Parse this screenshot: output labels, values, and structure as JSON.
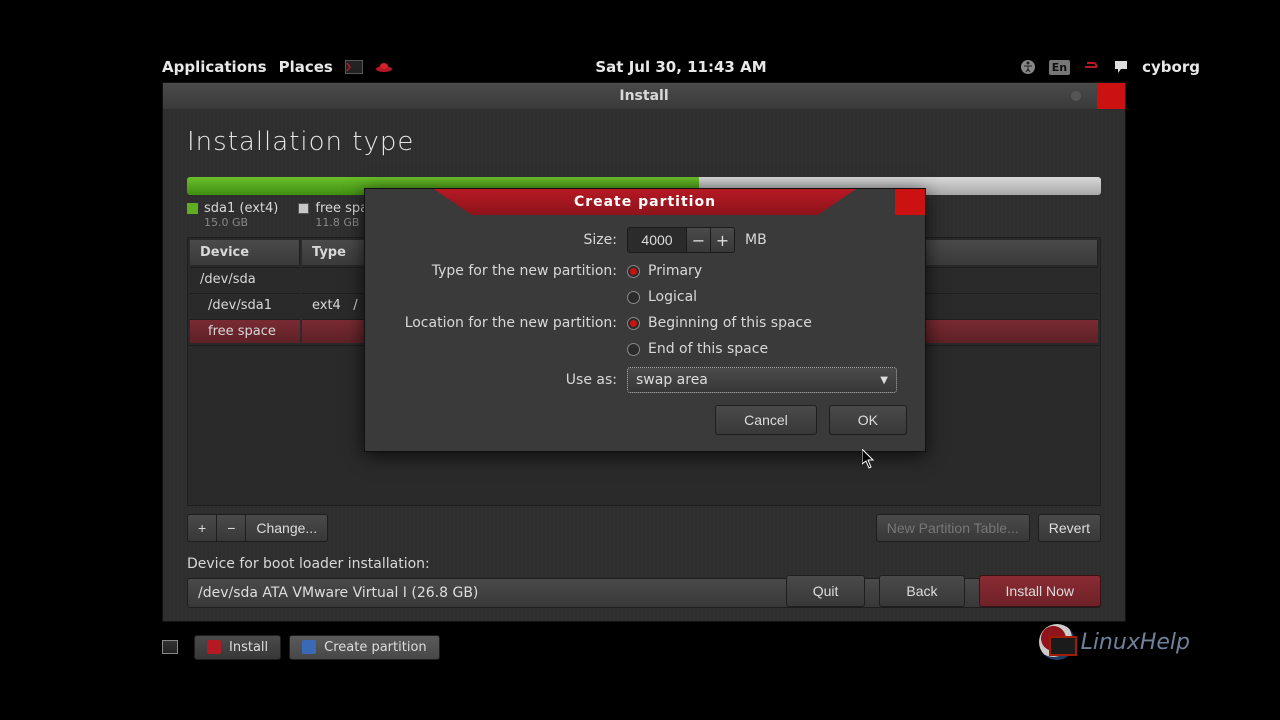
{
  "panel": {
    "apps": "Applications",
    "places": "Places",
    "clock": "Sat Jul 30, 11:43 AM",
    "lang": "En",
    "user": "cyborg"
  },
  "installer": {
    "window_title": "Install",
    "heading": "Installation type",
    "partitions_bar": {
      "seg1_label": "sda1 (ext4)",
      "seg1_size": "15.0 GB",
      "seg2_label": "free space",
      "seg2_size": "11.8 GB"
    },
    "table": {
      "headers": {
        "device": "Device",
        "type": "Type"
      },
      "rows": [
        {
          "device": "/dev/sda",
          "type": ""
        },
        {
          "device": "/dev/sda1",
          "type": "ext4",
          "mount": "/"
        },
        {
          "device": "free space",
          "type": ""
        }
      ]
    },
    "buttons": {
      "add": "+",
      "remove": "−",
      "change": "Change...",
      "new_table": "New Partition Table...",
      "revert": "Revert"
    },
    "bootloader": {
      "label": "Device for boot loader installation:",
      "value": "/dev/sda   ATA VMware Virtual I (26.8 GB)"
    },
    "nav": {
      "quit": "Quit",
      "back": "Back",
      "install": "Install Now"
    }
  },
  "dialog": {
    "title": "Create partition",
    "size_label": "Size:",
    "size_value": "4000",
    "size_unit": "MB",
    "type_label": "Type for the new partition:",
    "type_primary": "Primary",
    "type_logical": "Logical",
    "loc_label": "Location for the new partition:",
    "loc_begin": "Beginning of this space",
    "loc_end": "End of this space",
    "useas_label": "Use as:",
    "useas_value": "swap area",
    "cancel": "Cancel",
    "ok": "OK"
  },
  "taskbar": {
    "install": "Install",
    "create": "Create partition"
  },
  "watermark": "LinuxHelp"
}
